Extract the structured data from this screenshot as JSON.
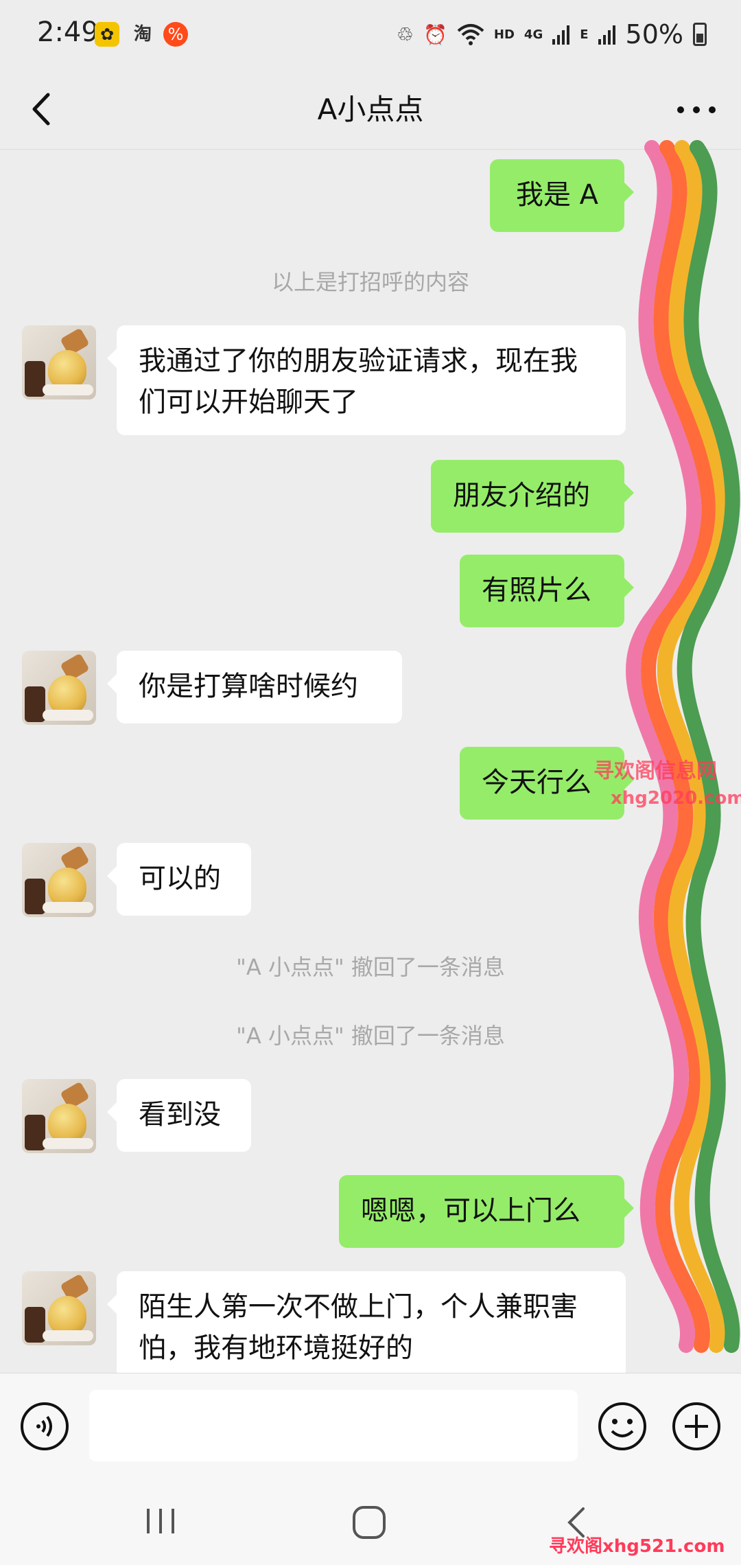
{
  "status_bar": {
    "time": "2:49",
    "app_icon_2": "淘",
    "network_hd": "HD",
    "network_4g": "4G",
    "network_e": "E",
    "battery_text": "50%"
  },
  "header": {
    "title": "A小点点"
  },
  "messages": [
    {
      "type": "out",
      "text": "我是 A"
    },
    {
      "type": "system",
      "text": "以上是打招呼的内容"
    },
    {
      "type": "in",
      "text": "我通过了你的朋友验证请求，现在我们可以开始聊天了"
    },
    {
      "type": "out",
      "text": "朋友介绍的"
    },
    {
      "type": "out",
      "text": "有照片么"
    },
    {
      "type": "in",
      "text": "你是打算啥时候约"
    },
    {
      "type": "out",
      "text": "今天行么"
    },
    {
      "type": "in",
      "text": "可以的"
    },
    {
      "type": "system",
      "text": "\"A 小点点\" 撤回了一条消息"
    },
    {
      "type": "system",
      "text": "\"A 小点点\" 撤回了一条消息"
    },
    {
      "type": "in",
      "text": "看到没"
    },
    {
      "type": "out",
      "text": "嗯嗯，可以上门么"
    },
    {
      "type": "in",
      "text": "陌生人第一次不做上门，个人兼职害怕，我有地环境挺好的"
    }
  ],
  "watermarks": {
    "top_line1": "寻欢阁信息网",
    "top_line2": "xhg2020.com",
    "bottom": "寻欢阁xhg521.com"
  },
  "icons": {
    "back": "chevron-left-icon",
    "more": "more-dots-icon",
    "voice": "voice-icon",
    "emoji": "emoji-icon",
    "plus": "plus-icon"
  },
  "colors": {
    "background": "#ededed",
    "outgoing_bubble": "#95ec69",
    "incoming_bubble": "#ffffff",
    "system_text": "#a8a8a8"
  }
}
